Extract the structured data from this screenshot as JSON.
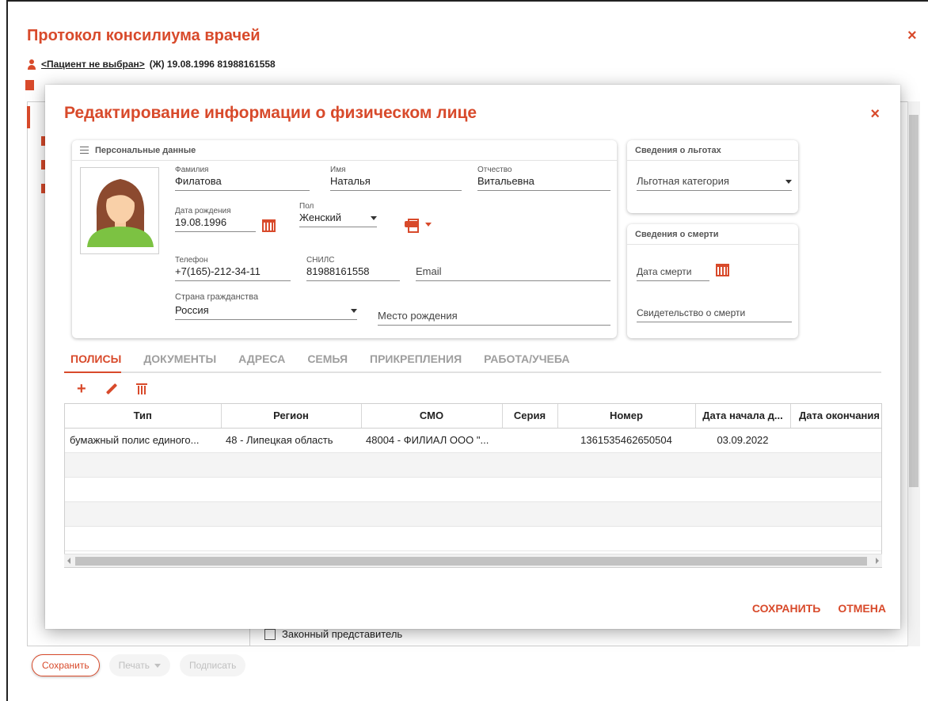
{
  "background": {
    "title": "Протокол консилиума врачей",
    "close": "×",
    "patient_link": "<Пациент не выбран>",
    "patient_info": "(Ж)  19.08.1996   81988161558",
    "legal_rep_label": "Законный представитель",
    "buttons": {
      "save": "Сохранить",
      "print": "Печать",
      "sign": "Подписать"
    }
  },
  "modal": {
    "title": "Редактирование информации о физическом лице",
    "close": "×",
    "personal": {
      "header": "Персональные данные",
      "surname_label": "Фамилия",
      "surname": "Филатова",
      "name_label": "Имя",
      "name": "Наталья",
      "patronymic_label": "Отчество",
      "patronymic": "Витальевна",
      "birth_label": "Дата рождения",
      "birth": "19.08.1996",
      "gender_label": "Пол",
      "gender": "Женский",
      "phone_label": "Телефон",
      "phone": "+7(165)-212-34-11",
      "snils_label": "СНИЛС",
      "snils": "81988161558",
      "email_placeholder": "Email",
      "citizenship_label": "Страна гражданства",
      "citizenship": "Россия",
      "birthplace_placeholder": "Место рождения"
    },
    "benefits": {
      "header": "Сведения о льготах",
      "category_placeholder": "Льготная категория"
    },
    "death": {
      "header": "Сведения о смерти",
      "date_placeholder": "Дата смерти",
      "certificate_placeholder": "Свидетельство о смерти"
    },
    "tabs": [
      "ПОЛИСЫ",
      "ДОКУМЕНТЫ",
      "АДРЕСА",
      "СЕМЬЯ",
      "ПРИКРЕПЛЕНИЯ",
      "РАБОТА/УЧЕБА"
    ],
    "toolbar": {
      "add": "+"
    },
    "grid": {
      "columns": [
        "Тип",
        "Регион",
        "СМО",
        "Серия",
        "Номер",
        "Дата начала д...",
        "Дата окончания"
      ],
      "rows": [
        [
          "бумажный полис единого...",
          "48 - Липецкая область",
          "48004 - ФИЛИАЛ ООО \"...",
          "",
          "1361535462650504",
          "03.09.2022",
          ""
        ]
      ]
    },
    "actions": {
      "save": "СОХРАНИТЬ",
      "cancel": "ОТМЕНА"
    }
  },
  "colors": {
    "accent": "#d84a2b"
  },
  "icons": [
    "close-icon",
    "person-icon",
    "building-icon",
    "menu-icon",
    "calendar-icon",
    "printer-icon",
    "chevron-down-icon",
    "plus-icon",
    "pencil-icon",
    "trash-icon"
  ]
}
